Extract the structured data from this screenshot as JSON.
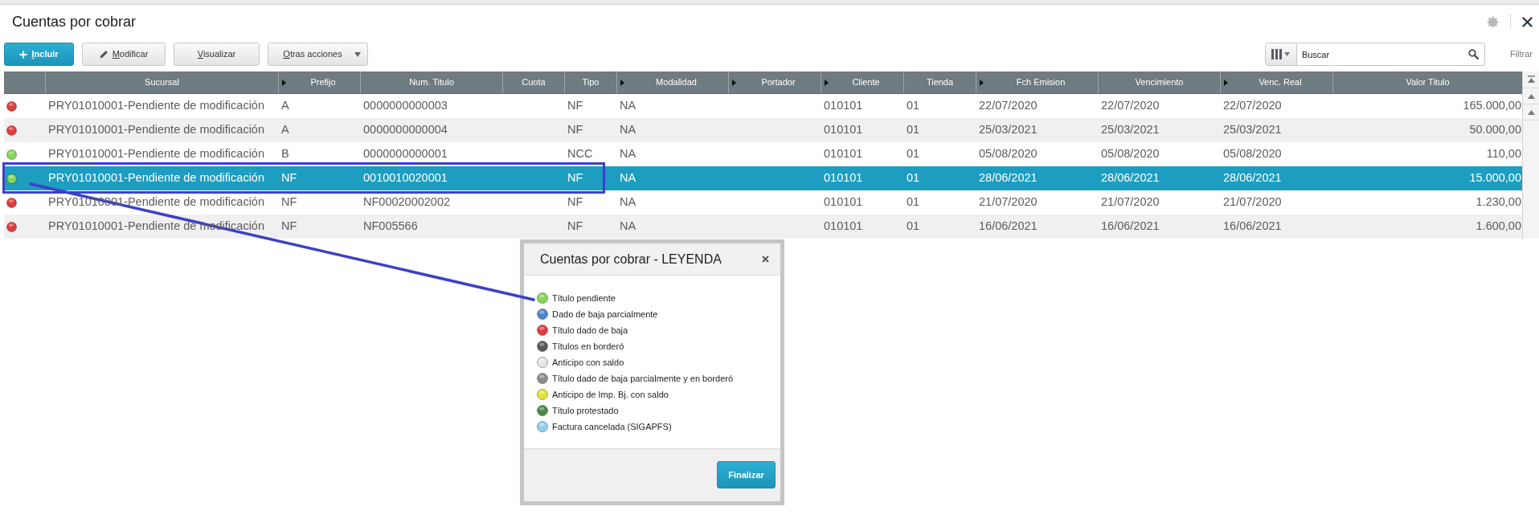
{
  "window": {
    "title": "Cuentas por cobrar"
  },
  "toolbar": {
    "buttons": [
      {
        "label": "Incluir",
        "kind": "add"
      },
      {
        "label": "Modificar",
        "kind": "edit"
      },
      {
        "label": "Visualizar",
        "kind": "plain"
      },
      {
        "label": "Otras acciones",
        "kind": "menu"
      }
    ]
  },
  "search": {
    "placeholder": "Buscar"
  },
  "filter_link": "Filtrar",
  "table": {
    "columns": [
      {
        "label": "Sucursal",
        "arrow": false
      },
      {
        "label": "Prefijo",
        "arrow": true
      },
      {
        "label": "Num. Titulo",
        "arrow": false
      },
      {
        "label": "Cuota",
        "arrow": false
      },
      {
        "label": "Tipo",
        "arrow": false
      },
      {
        "label": "Modalidad",
        "arrow": true
      },
      {
        "label": "Portador",
        "arrow": true
      },
      {
        "label": "Cliente",
        "arrow": true
      },
      {
        "label": "Tienda",
        "arrow": false
      },
      {
        "label": "Fch Emision",
        "arrow": true
      },
      {
        "label": "Vencimiento",
        "arrow": false
      },
      {
        "label": "Venc. Real",
        "arrow": true
      },
      {
        "label": "Valor Titulo",
        "arrow": false
      }
    ],
    "rows": [
      {
        "color": "#e03c3c",
        "selected": false,
        "sucursal": "PRY01010001-Pendiente de modificación",
        "prefijo": "A",
        "num_titulo": "0000000000003",
        "tipo": "NF",
        "modalidad": "NA",
        "cliente": "010101",
        "tienda": "01",
        "fch_emision": "22/07/2020",
        "vencimiento": "22/07/2020",
        "venc_real": "22/07/2020",
        "valor_titulo": "165.000,00"
      },
      {
        "color": "#e03c3c",
        "selected": false,
        "sucursal": "PRY01010001-Pendiente de modificación",
        "prefijo": "A",
        "num_titulo": "0000000000004",
        "tipo": "NF",
        "modalidad": "NA",
        "cliente": "010101",
        "tienda": "01",
        "fch_emision": "25/03/2021",
        "vencimiento": "25/03/2021",
        "venc_real": "25/03/2021",
        "valor_titulo": "50.000,00"
      },
      {
        "color": "#86d65a",
        "selected": false,
        "sucursal": "PRY01010001-Pendiente de modificación",
        "prefijo": "B",
        "num_titulo": "0000000000001",
        "tipo": "NCC",
        "modalidad": "NA",
        "cliente": "010101",
        "tienda": "01",
        "fch_emision": "05/08/2020",
        "vencimiento": "05/08/2020",
        "venc_real": "05/08/2020",
        "valor_titulo": "110,00"
      },
      {
        "color": "#86d65a",
        "selected": true,
        "sucursal": "PRY01010001-Pendiente de modificación",
        "prefijo": "NF",
        "num_titulo": "0010010020001",
        "tipo": "NF",
        "modalidad": "NA",
        "cliente": "010101",
        "tienda": "01",
        "fch_emision": "28/06/2021",
        "vencimiento": "28/06/2021",
        "venc_real": "28/06/2021",
        "valor_titulo": "15.000,00"
      },
      {
        "color": "#e03c3c",
        "selected": false,
        "sucursal": "PRY01010001-Pendiente de modificación",
        "prefijo": "NF",
        "num_titulo": "NF00020002002",
        "tipo": "NF",
        "modalidad": "NA",
        "cliente": "010101",
        "tienda": "01",
        "fch_emision": "21/07/2020",
        "vencimiento": "21/07/2020",
        "venc_real": "21/07/2020",
        "valor_titulo": "1.230,00"
      },
      {
        "color": "#e03c3c",
        "selected": false,
        "sucursal": "PRY01010001-Pendiente de modificación",
        "prefijo": "NF",
        "num_titulo": "NF005566",
        "tipo": "NF",
        "modalidad": "NA",
        "cliente": "010101",
        "tienda": "01",
        "fch_emision": "16/06/2021",
        "vencimiento": "16/06/2021",
        "venc_real": "16/06/2021",
        "valor_titulo": "1.600,00"
      }
    ]
  },
  "legend": {
    "title": "Cuentas por cobrar - LEYENDA",
    "items": [
      {
        "label": "Título pendiente",
        "color": "#86d65a"
      },
      {
        "label": "Dado de baja parcialmente",
        "color": "#4d86c6"
      },
      {
        "label": "Título dado de baja",
        "color": "#e03c3c"
      },
      {
        "label": "Títulos en borderó",
        "color": "#5a5a5a"
      },
      {
        "label": "Anticipo con saldo",
        "color": "#e6e6e6"
      },
      {
        "label": "Título dado de baja parcialmente y en borderó",
        "color": "#8c8c8c"
      },
      {
        "label": "Anticipo de Imp. Bj. con saldo",
        "color": "#e3e33a"
      },
      {
        "label": "Título protestado",
        "color": "#4a8a4a"
      },
      {
        "label": "Factura cancelada (SIGAPFS)",
        "color": "#8fd0f0"
      }
    ],
    "button": "Finalizar"
  }
}
